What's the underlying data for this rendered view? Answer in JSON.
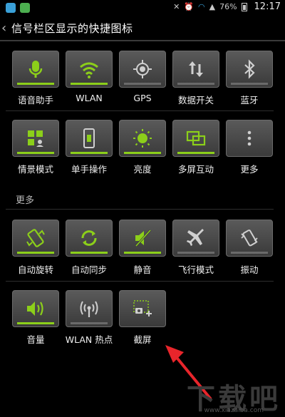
{
  "status_bar": {
    "battery": "76%",
    "time": "12:17"
  },
  "title_bar": {
    "title": "信号栏区显示的快捷图标"
  },
  "tiles": [
    {
      "label": "语音助手",
      "icon": "mic-icon",
      "state": "on"
    },
    {
      "label": "WLAN",
      "icon": "wifi-icon",
      "state": "on"
    },
    {
      "label": "GPS",
      "icon": "gps-icon",
      "state": "off"
    },
    {
      "label": "数据开关",
      "icon": "data-toggle-icon",
      "state": "off"
    },
    {
      "label": "蓝牙",
      "icon": "bluetooth-icon",
      "state": "off"
    },
    {
      "label": "情景模式",
      "icon": "scene-mode-icon",
      "state": "on"
    },
    {
      "label": "单手操作",
      "icon": "one-hand-icon",
      "state": "on"
    },
    {
      "label": "亮度",
      "icon": "brightness-icon",
      "state": "on"
    },
    {
      "label": "多屏互动",
      "icon": "multiscreen-icon",
      "state": "on"
    },
    {
      "label": "更多",
      "icon": "more-icon",
      "state": "none"
    }
  ],
  "more_section": {
    "header": "更多"
  },
  "more_tiles": [
    {
      "label": "自动旋转",
      "icon": "auto-rotate-icon",
      "state": "on"
    },
    {
      "label": "自动同步",
      "icon": "sync-icon",
      "state": "on"
    },
    {
      "label": "静音",
      "icon": "mute-icon",
      "state": "on"
    },
    {
      "label": "飞行模式",
      "icon": "airplane-icon",
      "state": "off"
    },
    {
      "label": "振动",
      "icon": "vibrate-icon",
      "state": "off"
    },
    {
      "label": "音量",
      "icon": "volume-icon",
      "state": "on"
    },
    {
      "label": "WLAN 热点",
      "icon": "hotspot-icon",
      "state": "off"
    },
    {
      "label": "截屏",
      "icon": "screenshot-icon",
      "state": "none"
    }
  ],
  "watermark": {
    "text": "下载吧",
    "url": "www.xiazaiba.com"
  },
  "colors": {
    "accent": "#8ccf1a",
    "tile": "#4a4a4a",
    "background": "#000000"
  }
}
